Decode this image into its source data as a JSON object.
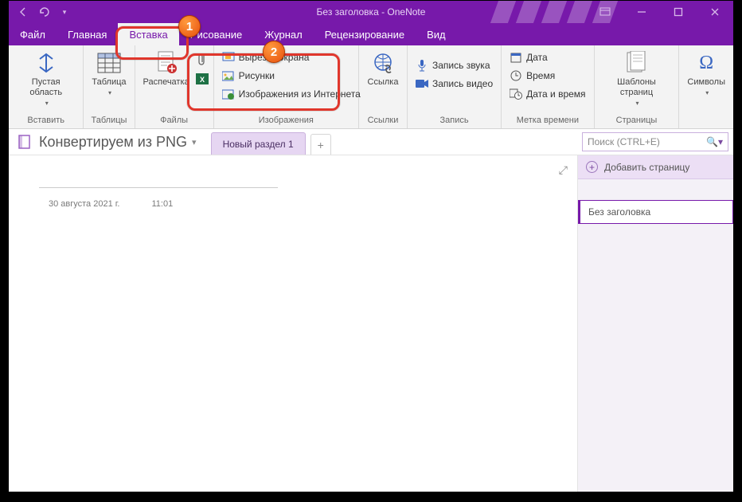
{
  "title": "Без заголовка - OneNote",
  "tabs": {
    "file": "Файл",
    "home": "Главная",
    "insert": "Вставка",
    "draw": "Рисование",
    "journal": "Журнал",
    "review": "Рецензирование",
    "view": "Вид"
  },
  "ribbon": {
    "insert_group": {
      "label": "Вставить",
      "blank_area": "Пустая область"
    },
    "tables_group": {
      "label": "Таблицы",
      "table": "Таблица"
    },
    "files_group": {
      "label": "Файлы",
      "printout": "Распечатка"
    },
    "images_group": {
      "label": "Изображения",
      "clip": "Вырезка экрана",
      "pictures": "Рисунки",
      "online": "Изображения из Интернета"
    },
    "links_group": {
      "label": "Ссылки",
      "link": "Ссылка"
    },
    "record_group": {
      "label": "Запись",
      "audio": "Запись звука",
      "video": "Запись видео"
    },
    "stamp_group": {
      "label": "Метка времени",
      "date": "Дата",
      "time": "Время",
      "datetime": "Дата и время"
    },
    "pages_group": {
      "label": "Страницы",
      "templates": "Шаблоны страниц"
    },
    "symbols_group": {
      "label": "",
      "symbols": "Символы"
    }
  },
  "notebook": {
    "name": "Конвертируем из PNG",
    "section": "Новый раздел 1",
    "add_tab": "+"
  },
  "search": {
    "placeholder": "Поиск (CTRL+E)"
  },
  "pages_pane": {
    "add_page": "Добавить страницу",
    "page1": "Без заголовка"
  },
  "canvas": {
    "date": "30 августа 2021 г.",
    "time": "11:01"
  },
  "annotations": {
    "b1": "1",
    "b2": "2"
  }
}
